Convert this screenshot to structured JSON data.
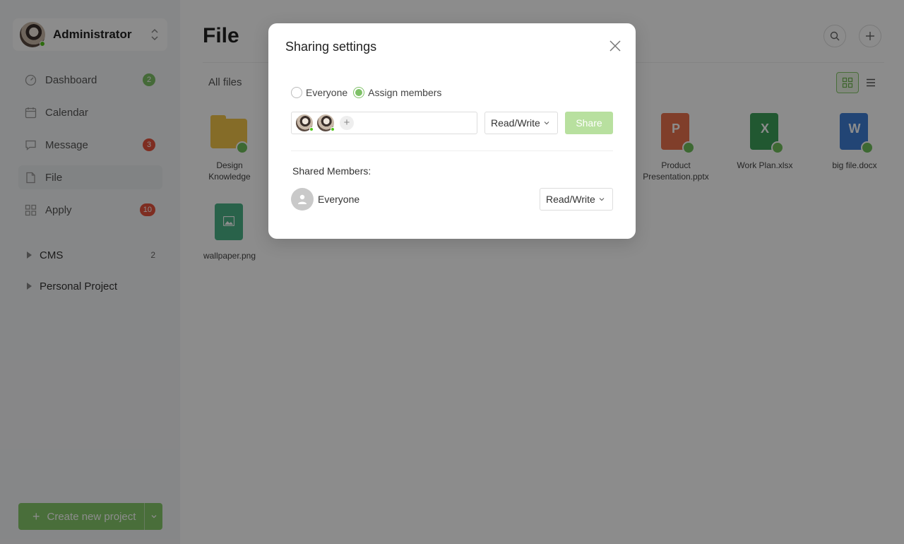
{
  "user": {
    "name": "Administrator"
  },
  "nav": [
    {
      "label": "Dashboard",
      "badge": "2"
    },
    {
      "label": "Calendar"
    },
    {
      "label": "Message",
      "badge": "3"
    },
    {
      "label": "File"
    },
    {
      "label": "Apply",
      "badge": "10"
    }
  ],
  "groups": [
    {
      "label": "CMS",
      "count": "2"
    },
    {
      "label": "Personal Project"
    }
  ],
  "create_label": "Create new project",
  "page": {
    "title": "File",
    "filter_label": "All files"
  },
  "files": [
    {
      "name": "Design Knowledge",
      "type": "folder",
      "color": "#f3c54a"
    },
    {
      "name": "Product Presentation.pptx",
      "type": "pptx",
      "letter": "P",
      "color": "#e9714d"
    },
    {
      "name": "Work Plan.xlsx",
      "type": "xlsx",
      "letter": "X",
      "color": "#3da05a"
    },
    {
      "name": "big file.docx",
      "type": "docx",
      "letter": "W",
      "color": "#3f7fd6"
    },
    {
      "name": "wallpaper.png",
      "type": "image",
      "color": "#4bb387"
    }
  ],
  "modal": {
    "title": "Sharing settings",
    "options": [
      "Everyone",
      "Assign members"
    ],
    "selected_option": "Assign members",
    "permission": "Read/Write",
    "share_label": "Share",
    "shared_members_label": "Shared Members:",
    "shared_members": [
      {
        "name": "Everyone",
        "permission": "Read/Write"
      }
    ]
  },
  "colors": {
    "accent": "#7ec167",
    "badge_red": "#e5533d"
  }
}
